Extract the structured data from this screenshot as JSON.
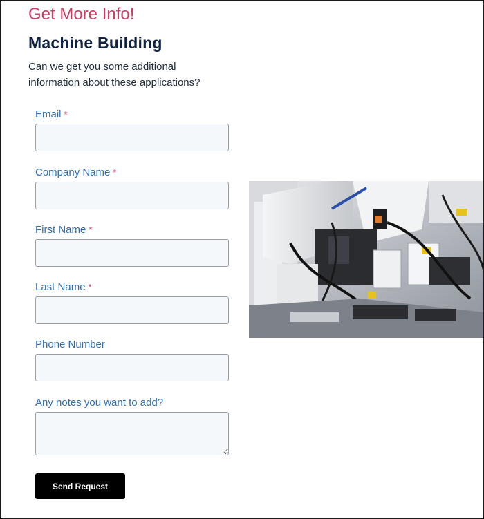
{
  "header": {
    "eyebrow": "Get More Info!",
    "title": "Machine Building",
    "intro": "Can we get you some additional information about these applications?"
  },
  "form": {
    "required_mark": "*",
    "fields": [
      {
        "label": "Email",
        "required": true,
        "value": ""
      },
      {
        "label": "Company Name",
        "required": true,
        "value": ""
      },
      {
        "label": "First Name",
        "required": true,
        "value": ""
      },
      {
        "label": "Last Name",
        "required": true,
        "value": ""
      },
      {
        "label": "Phone Number",
        "required": false,
        "value": ""
      },
      {
        "label": "Any notes you want to add?",
        "required": false,
        "value": ""
      }
    ],
    "submit_label": "Send Request"
  },
  "image": {
    "icon": "industrial-machine-photo"
  },
  "colors": {
    "accent_pink": "#d23a63",
    "title_navy": "#0f2340",
    "label_blue": "#2f6fb0",
    "input_bg": "#f5f8fa",
    "button_bg": "#000000"
  }
}
